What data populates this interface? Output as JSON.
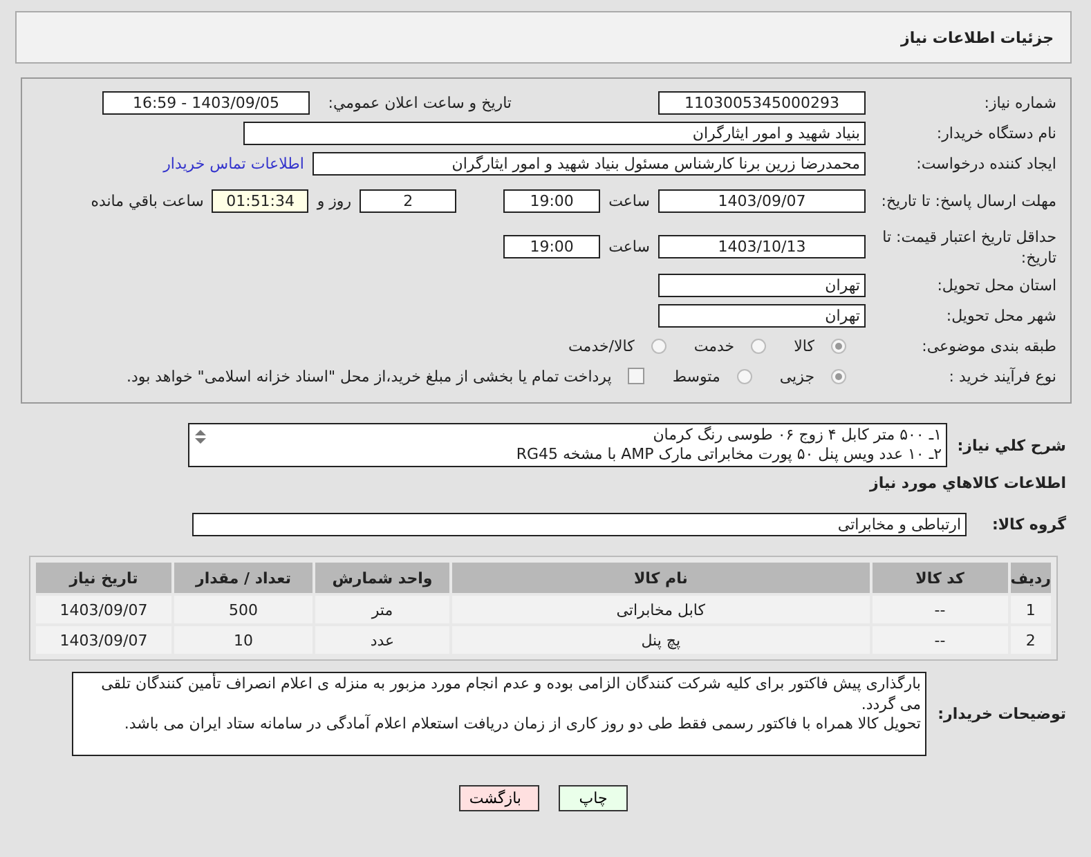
{
  "header": {
    "title": "جزئیات اطلاعات نیاز"
  },
  "need_number": {
    "label": "شماره نیاز:",
    "value": "1103005345000293"
  },
  "announce": {
    "label": "تاریخ و ساعت اعلان عمومي:",
    "value": "1403/09/05 - 16:59"
  },
  "buyer_org": {
    "label": "نام دستگاه خریدار:",
    "value": "بنیاد شهید و امور ایثارگران"
  },
  "creator": {
    "label": "ایجاد کننده درخواست:",
    "value": "محمدرضا زرین برنا کارشناس مسئول  بنیاد شهید و امور ایثارگران",
    "contact_link": "اطلاعات تماس خریدار"
  },
  "response_deadline": {
    "label": "مهلت ارسال پاسخ: تا تاریخ:",
    "date": "1403/09/07",
    "time_label": "ساعت",
    "time": "19:00",
    "days": "2",
    "days_label": "روز و",
    "remaining": "01:51:34",
    "remaining_label": "ساعت باقي مانده"
  },
  "validity": {
    "label": "حداقل تاریخ اعتبار قیمت: تا تاریخ:",
    "date": "1403/10/13",
    "time_label": "ساعت",
    "time": "19:00"
  },
  "province": {
    "label": "استان محل تحویل:",
    "value": "تهران"
  },
  "city": {
    "label": "شهر محل تحویل:",
    "value": "تهران"
  },
  "category": {
    "label": "طبقه بندی موضوعی:",
    "options": [
      {
        "label": "کالا",
        "selected": true
      },
      {
        "label": "خدمت",
        "selected": false
      },
      {
        "label": "کالا/خدمت",
        "selected": false
      }
    ]
  },
  "process": {
    "label": "نوع فرآیند خرید :",
    "options": [
      {
        "label": "جزیی",
        "selected": true
      },
      {
        "label": "متوسط",
        "selected": false
      }
    ],
    "payment": {
      "label": "پرداخت تمام یا بخشی از مبلغ خرید،از محل \"اسناد خزانه اسلامی\" خواهد بود.",
      "checked": false
    }
  },
  "description": {
    "label": "شرح کلي نياز:",
    "lines": [
      "۱ـ ۵۰۰ متر کابل ۴ زوج ۰۶ طوسی رنگ کرمان",
      "۲ـ ۱۰ عدد ویس پنل ۵۰ پورت مخابراتی مارک AMP با مشخه RG45"
    ]
  },
  "goods_section": {
    "title": "اطلاعات کالاهاي مورد نياز"
  },
  "goods_group": {
    "label": "گروه کالا:",
    "value": "ارتباطی و مخابراتی"
  },
  "table": {
    "columns": [
      "رديف",
      "کد کالا",
      "نام کالا",
      "واحد شمارش",
      "تعداد / مقدار",
      "تاریخ نیاز"
    ],
    "rows": [
      [
        "1",
        "--",
        "کابل مخابراتی",
        "متر",
        "500",
        "1403/09/07"
      ],
      [
        "2",
        "--",
        "پچ پنل",
        "عدد",
        "10",
        "1403/09/07"
      ]
    ]
  },
  "buyer_notes": {
    "label": "توضیحات خریدار:",
    "lines": [
      "بارگذاری پیش فاکتور برای کلیه شرکت کنندگان الزامی بوده و عدم انجام مورد مزبور به منزله ی اعلام انصراف تأمین کنندگان تلقی می گردد.",
      "تحویل کالا همراه با فاکتور رسمی فقط طی دو روز کاری از زمان دریافت استعلام اعلام آمادگی در سامانه ستاد ایران می باشد."
    ]
  },
  "buttons": [
    {
      "label": "چاپ",
      "kind": "print"
    },
    {
      "label": "بازگشت",
      "kind": "back"
    }
  ]
}
